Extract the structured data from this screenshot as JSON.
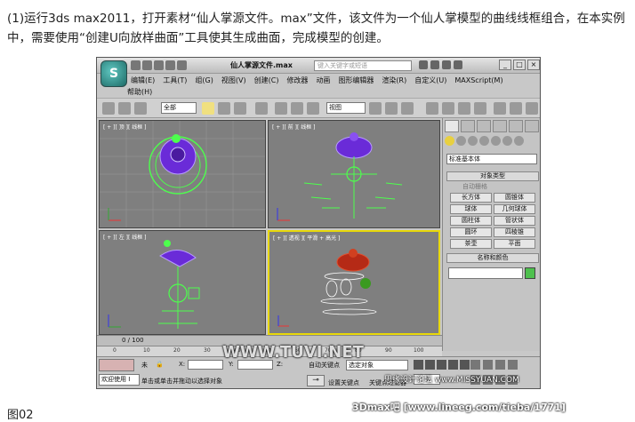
{
  "doc": {
    "paragraph": "(1)运行3ds max2011，打开素材“仙人掌源文件。max”文件，该文件为一个仙人掌模型的曲线线框组合，在本实例中，需要使用“创建U向放样曲面”工具使其生成曲面，完成模型的创建。",
    "caption": "图02"
  },
  "watermarks": {
    "tuvi": "WWW.TUVI.NET",
    "forum": "思缘设计论坛 www.MISSYUAN.COM",
    "lineeg": "3Dmax吧 [www.lineeg.com/tieba/1771]"
  },
  "app": {
    "logo_glyph": "S",
    "title": "仙人掌源文件.max",
    "search_placeholder": "键入关键字或短语",
    "menu": [
      "编辑(E)",
      "工具(T)",
      "组(G)",
      "视图(V)",
      "创建(C)",
      "修改器",
      "动画",
      "图形编辑器",
      "渲染(R)",
      "自定义(U)",
      "MAXScript(M)"
    ],
    "help_menu": "帮助(H)",
    "selection_filter": "全部",
    "ref_coord": "视图",
    "viewports": {
      "top": "[ + ][ 顶 ][ 线框 ]",
      "front": "[ + ][ 前 ][ 线框 ]",
      "left": "[ + ][ 左 ][ 线框 ]",
      "persp": "[ + ][ 透视 ][ 平滑 + 高光 ]"
    },
    "command_panel": {
      "dropdown": "标准基本体",
      "object_type_header": "对象类型",
      "autogrid": "自动栅格",
      "objects": [
        "长方体",
        "圆锥体",
        "球体",
        "几何球体",
        "圆柱体",
        "管状体",
        "圆环",
        "四棱锥",
        "茶壶",
        "平面"
      ],
      "name_color_header": "名称和颜色"
    },
    "timeline": {
      "frame_label": "0 / 100",
      "ticks": [
        "0",
        "10",
        "20",
        "30",
        "40",
        "50",
        "60",
        "70",
        "80",
        "90",
        "100"
      ]
    },
    "status": {
      "welcome": "欢迎使用 I",
      "not_selected": "未",
      "x_label": "X:",
      "y_label": "Y:",
      "z_label": "Z:",
      "prompt": "单击或单击并拖动以选择对象",
      "autokey": "自动关键点",
      "setkey": "设置关键点",
      "key_filters": "关键点过滤器",
      "selected_object": "选定对象",
      "frame_value": "0"
    },
    "colors": {
      "wire_green": "#4dff4d",
      "cactus_purple": "#6a2bd8",
      "active_viewport": "#e8d80a",
      "cactus_red": "#b52a16"
    }
  }
}
